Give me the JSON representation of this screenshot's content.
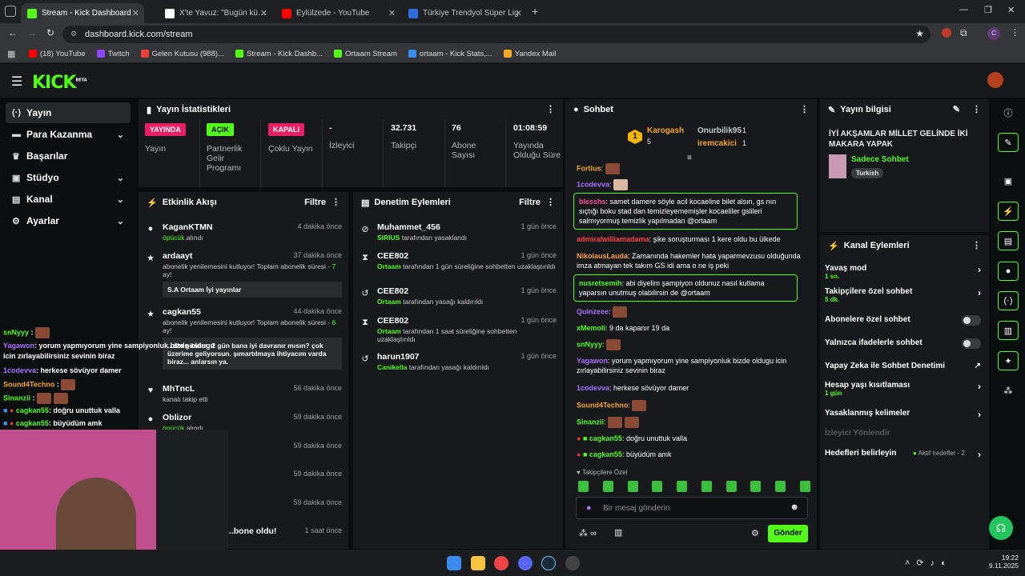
{
  "browser": {
    "tabs": [
      {
        "label": "Stream - Kick Dashboard",
        "color": "#53fc18"
      },
      {
        "label": "X'te Yavuz: \"Bugün küçük bir ya...",
        "color": "#ffffff"
      },
      {
        "label": "Eylülzede - YouTube",
        "color": "#ff0000"
      },
      {
        "label": "Türkiye Trendyol Süper Lig - 20...",
        "color": "#2d6cdf"
      }
    ],
    "url": "dashboard.kick.com/stream",
    "profile_initial": "C",
    "bookmarks": [
      {
        "label": "(18) YouTube",
        "color": "#ff0000"
      },
      {
        "label": "Twitch",
        "color": "#9146ff"
      },
      {
        "label": "Gelen Kutusu (988)...",
        "color": "#ea4335"
      },
      {
        "label": "Stream - Kick Dashb...",
        "color": "#53fc18"
      },
      {
        "label": "Ortaam Stream",
        "color": "#53fc18"
      },
      {
        "label": "ortaam - Kick Stats,...",
        "color": "#3c8cf0"
      },
      {
        "label": "Yandex Mail",
        "color": "#f5a623"
      }
    ]
  },
  "kick": {
    "logo": "KICK",
    "beta": "BETA"
  },
  "sidebar": {
    "items": [
      {
        "label": "Yayın",
        "icon": "broadcast-icon"
      },
      {
        "label": "Para Kazanma",
        "icon": "money-icon"
      },
      {
        "label": "Başarılar",
        "icon": "trophy-icon"
      },
      {
        "label": "Stüdyo",
        "icon": "studio-icon"
      },
      {
        "label": "Kanal",
        "icon": "channel-icon"
      },
      {
        "label": "Ayarlar",
        "icon": "gear-icon"
      }
    ]
  },
  "stats": {
    "title": "Yayın İstatistikleri",
    "items": [
      {
        "badge": "YAYINDA",
        "label": "Yayın",
        "badge_color": "#e91e63"
      },
      {
        "badge": "AÇIK",
        "label": "Partnerlik Gelir Programı",
        "badge_color": "#53fc18"
      },
      {
        "badge": "KAPALI",
        "label": "Çoklu Yayın",
        "badge_color": "#e91e63"
      },
      {
        "value": "-",
        "label": "İzleyici"
      },
      {
        "value": "32.731",
        "label": "Takipçi"
      },
      {
        "value": "76",
        "label": "Abone Sayısı"
      },
      {
        "value": "01:08:59",
        "label": "Yayında Olduğu Süre"
      }
    ]
  },
  "activity": {
    "title": "Etkinlik Akışı",
    "filter": "Filtre",
    "events": [
      {
        "name": "KaganKTMN",
        "time": "4 dakika önce",
        "sub_green": "öpücük",
        "sub": " alındı"
      },
      {
        "name": "ardaayt",
        "time": "37 dakika önce",
        "sub": "abonelik yenilemesini kutluyor! Toplam abonelik süresi - ",
        "sub_green": "7",
        "sub2": " ay!",
        "msg": "S.A Ortaam İyi yayınlar"
      },
      {
        "name": "cagkan55",
        "time": "44 dakika önce",
        "sub": "abonelik yenilemesini kutluyor! Toplam abonelik süresi - ",
        "sub_green": "6",
        "sub2": " ay!",
        "msg": "...din günüm. 2 gün bana iyi davranır mısın? çok üzerime geliyorsun. şımartılmaya ihtiyacım varda biraz... anlarsın ya."
      },
      {
        "name": "MhTncL",
        "time": "56 dakika önce",
        "sub": "kanalı takip etti"
      },
      {
        "name": "Oblizor",
        "time": "59 dakika önce",
        "sub_green": "öpücük",
        "sub": " alındı"
      },
      {
        "name": "",
        "time": "59 dakika önce"
      },
      {
        "name": "",
        "time": "59 dakika önce"
      },
      {
        "name": "",
        "time": "59 dakika önce"
      },
      {
        "name": "...bone oldu!",
        "time": "1 saat önce"
      }
    ]
  },
  "moderation": {
    "title": "Denetim Eylemleri",
    "filter": "Filtre",
    "events": [
      {
        "name": "Muhammet_456",
        "time": "1 gün önce",
        "who": "SIRIUS",
        "text": " tarafından yasaklandı"
      },
      {
        "name": "CEE802",
        "time": "1 gün önce",
        "who": "Ortaam",
        "text": " tarafından 1 gün süreliğine sohbetten uzaklaştırıldı"
      },
      {
        "name": "CEE802",
        "time": "1 gün önce",
        "who": "Ortaam",
        "text": " tarafından yasağı kaldırıldı"
      },
      {
        "name": "CEE802",
        "time": "1 gün önce",
        "who": "Ortaam",
        "text": " tarafından 1 saat süreliğine sohbetten uzaklaştırıldı"
      },
      {
        "name": "harun1907",
        "time": "1 gün önce",
        "who": "Canikella",
        "text": " tarafından yasağı kaldırıldı"
      }
    ]
  },
  "chat": {
    "title": "Sohbet",
    "top": {
      "rank": "1",
      "name1": "Karogash",
      "count1": "5",
      "name2": "Onurbilik95",
      "count2": "1",
      "name3": "iremcakici",
      "count3": "1"
    },
    "messages": [
      {
        "user": "Fortius",
        "color": "#f5a623",
        "text": ":"
      },
      {
        "user": "1codevva",
        "color": "#a970ff",
        "text": ":"
      },
      {
        "user": "blesshs",
        "color": "#ff4f9a",
        "text": ": samet damere söyle acil kocaeline bilet alsın, gs nın sıçtığı boku stad dan temizleyememişler kocaeliler gslileri salmıyormuş temizlik yapılmadan @ortaam",
        "highlight": true
      },
      {
        "user": "admiralwilliamadama",
        "color": "#ff4040",
        "text": ": şike soruşturması 1 kere oldu bu ülkede"
      },
      {
        "user": "NikolausLauda",
        "color": "#ffa040",
        "text": ": Zamanında hakemler hata yaparmevzusu olduğunda imza atmayan tek takım GS idi ama o ne iş peki"
      },
      {
        "user": "nusretsemih",
        "color": "#53fc18",
        "text": ": abi diyelim şampiyon oldunuz nasıl kutlama yaparsın unutmuş olabilirsin de @ortaam",
        "highlight": true
      },
      {
        "user": "Quinzeee",
        "color": "#a970ff",
        "text": ":"
      },
      {
        "user": "xMemoli",
        "color": "#53fc18",
        "text": ": 9 da kapanır 19 da"
      },
      {
        "user": "snNyyy",
        "color": "#53fc18",
        "text": ":"
      },
      {
        "user": "Yagawon",
        "color": "#a970ff",
        "text": ": yorum yapmıyorum yine sampiyonluk bizde oldugu icin zırlayabilirsiniz sevinin biraz"
      },
      {
        "user": "1codevva",
        "color": "#a970ff",
        "text": ": herkese sövüyor damer"
      },
      {
        "user": "Sound4Techno",
        "color": "#f5a623",
        "text": ":"
      },
      {
        "user": "Sinanzii",
        "color": "#53fc18",
        "text": ":"
      },
      {
        "user": "cagkan55",
        "color": "#53fc18",
        "text": ": doğru unuttuk valla"
      },
      {
        "user": "cagkan55",
        "color": "#53fc18",
        "text": ": büyüdüm amk"
      }
    ],
    "followers_only": "Takipçilere Özel",
    "input_placeholder": "Bir mesaj gönderin",
    "send": "Gönder"
  },
  "info": {
    "title": "Yayın bilgisi",
    "stream_title": "İYİ AKŞAMLAR MİLLET GELİNDE İKİ MAKARA YAPAK",
    "category": "Sadece Sohbet",
    "tag": "Turkish"
  },
  "channel_actions": {
    "title": "Kanal Eylemleri",
    "items": [
      {
        "label": "Yavaş mod",
        "sub": "1 sn.",
        "type": "arrow"
      },
      {
        "label": "Takipçilere özel sohbet",
        "sub": "5 dk.",
        "type": "arrow"
      },
      {
        "label": "Abonelere özel sohbet",
        "type": "toggle"
      },
      {
        "label": "Yalnızca ifadelerle sohbet",
        "type": "toggle"
      },
      {
        "label": "Yapay Zeka ile Sohbet Denetimi",
        "type": "ext"
      },
      {
        "label": "Hesap yaşı kısıtlaması",
        "sub": "1 gün",
        "type": "arrow"
      },
      {
        "label": "Yasaklanmış kelimeler",
        "type": "arrow"
      },
      {
        "label": "İzleyici Yönlendir",
        "type": "disabled"
      },
      {
        "label": "Hedefleri belirleyin",
        "extra": "Aktif hedefler - 2",
        "type": "arrow"
      }
    ]
  },
  "overlay_chat": [
    {
      "user": "snNyyy",
      "text": " :"
    },
    {
      "user": "Yagawon",
      "text": ": yorum yapmıyorum yine sampiyonluk bizde oldugu icin zırlayabilirsiniz sevinin biraz"
    },
    {
      "user": "1codevva",
      "text": ": herkese sövüyor damer"
    },
    {
      "user": "Sound4Techno",
      "text": " :"
    },
    {
      "user": "Sinanzii",
      "text": " :"
    },
    {
      "user": "cagkan55",
      "text": ": doğru unuttuk valla"
    },
    {
      "user": "cagkan55",
      "text": ": büyüdüm amk"
    }
  ],
  "taskbar": {
    "time": "19:22",
    "date": "9.11.2025"
  }
}
